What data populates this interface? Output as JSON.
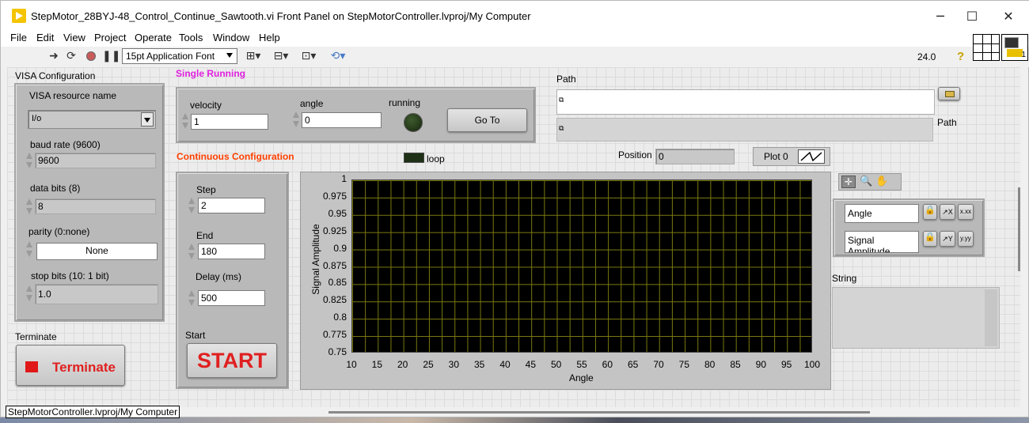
{
  "window": {
    "title": "StepMotor_28BYJ-48_Control_Continue_Sawtooth.vi Front Panel on StepMotorController.lvproj/My Computer",
    "minimize_icon": "minimize-icon",
    "maximize_icon": "maximize-icon",
    "close_icon": "close-icon"
  },
  "menu": [
    "File",
    "Edit",
    "View",
    "Project",
    "Operate",
    "Tools",
    "Window",
    "Help"
  ],
  "toolbar": {
    "font": "15pt Application Font",
    "version": "24.0",
    "icons": [
      "run-arrow-icon",
      "run-continuously-icon",
      "abort-icon",
      "pause-icon",
      "align-icon",
      "distribute-icon",
      "resize-icon",
      "reorder-icon",
      "help-icon"
    ]
  },
  "visa": {
    "section_label": "VISA Configuration",
    "resource_label": "VISA resource name",
    "resource_value": "I/o",
    "baud_label": "baud rate (9600)",
    "baud_value": "9600",
    "databits_label": "data bits (8)",
    "databits_value": "8",
    "parity_label": "parity (0:none)",
    "parity_value": "None",
    "stopbits_label": "stop bits (10: 1 bit)",
    "stopbits_value": "1.0"
  },
  "single": {
    "section_label": "Single Running",
    "velocity_label": "velocity",
    "velocity_value": "1",
    "angle_label": "angle",
    "angle_value": "0",
    "running_label": "running",
    "running_on": false,
    "goto_label": "Go To"
  },
  "path": {
    "label": "Path",
    "value": "",
    "indicator_label": "Path",
    "indicator_value": ""
  },
  "continuous": {
    "section_label": "Continuous Configuration",
    "step_label": "Step",
    "step_value": "2",
    "end_label": "End",
    "end_value": "180",
    "delay_label": "Delay (ms)",
    "delay_value": "500",
    "start_label": "Start",
    "start_button": "START"
  },
  "loop": {
    "label": "loop",
    "on": false
  },
  "position": {
    "label": "Position",
    "value": "0"
  },
  "plot_legend": {
    "label": "Plot 0"
  },
  "scale_legend": {
    "x_name": "Angle",
    "y_name": "Signal Amplitude"
  },
  "string_ind": {
    "label": "String",
    "value": ""
  },
  "terminate": {
    "label": "Terminate",
    "button": "Terminate"
  },
  "status": {
    "text": "StepMotorController.lvproj/My Computer"
  },
  "colors": {
    "plot_bg": "#000000",
    "grid": "#7a7a10",
    "section_red": "#ff4000",
    "section_magenta": "#e020e0",
    "start_red": "#e02020"
  },
  "chart_data": {
    "type": "line",
    "title": "",
    "xlabel": "Angle",
    "ylabel": "Signal Amplitude",
    "xlim": [
      10,
      100
    ],
    "ylim": [
      0.75,
      1
    ],
    "x_ticks": [
      "10",
      "15",
      "20",
      "25",
      "30",
      "35",
      "40",
      "45",
      "50",
      "55",
      "60",
      "65",
      "70",
      "75",
      "80",
      "85",
      "90",
      "95",
      "100"
    ],
    "y_ticks": [
      "1",
      "0.975",
      "0.95",
      "0.925",
      "0.9",
      "0.875",
      "0.85",
      "0.825",
      "0.8",
      "0.775",
      "0.75"
    ],
    "series": [],
    "grid": true
  }
}
